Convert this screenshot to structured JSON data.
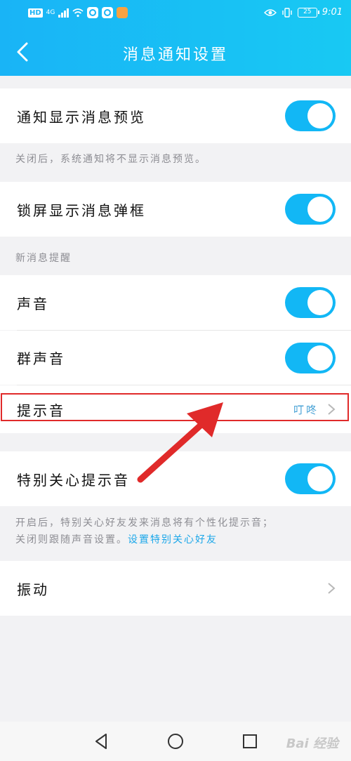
{
  "status_bar": {
    "hd": "HD",
    "network": "4G",
    "battery": "25",
    "time": "9:01"
  },
  "header": {
    "title": "消息通知设置"
  },
  "settings": {
    "preview": {
      "label": "通知显示消息预览",
      "enabled": true
    },
    "preview_note": "关闭后，系统通知将不显示消息预览。",
    "lock_popup": {
      "label": "锁屏显示消息弹框",
      "enabled": true
    },
    "section_new_msg": "新消息提醒",
    "sound": {
      "label": "声音",
      "enabled": true
    },
    "group_sound": {
      "label": "群声音",
      "enabled": true
    },
    "ringtone": {
      "label": "提示音",
      "value": "叮咚"
    },
    "special_care": {
      "label": "特别关心提示音",
      "enabled": true
    },
    "special_note_line1": "开启后，特别关心好友发来消息将有个性化提示音；",
    "special_note_line2": "关闭则跟随声音设置。",
    "special_note_link": "设置特别关心好友",
    "vibrate": {
      "label": "振动"
    }
  },
  "annotation": {
    "color": "#e02a2a"
  },
  "colors": {
    "accent": "#12b7f5",
    "header": "#19b4f6"
  },
  "watermark": "Bai 经验"
}
